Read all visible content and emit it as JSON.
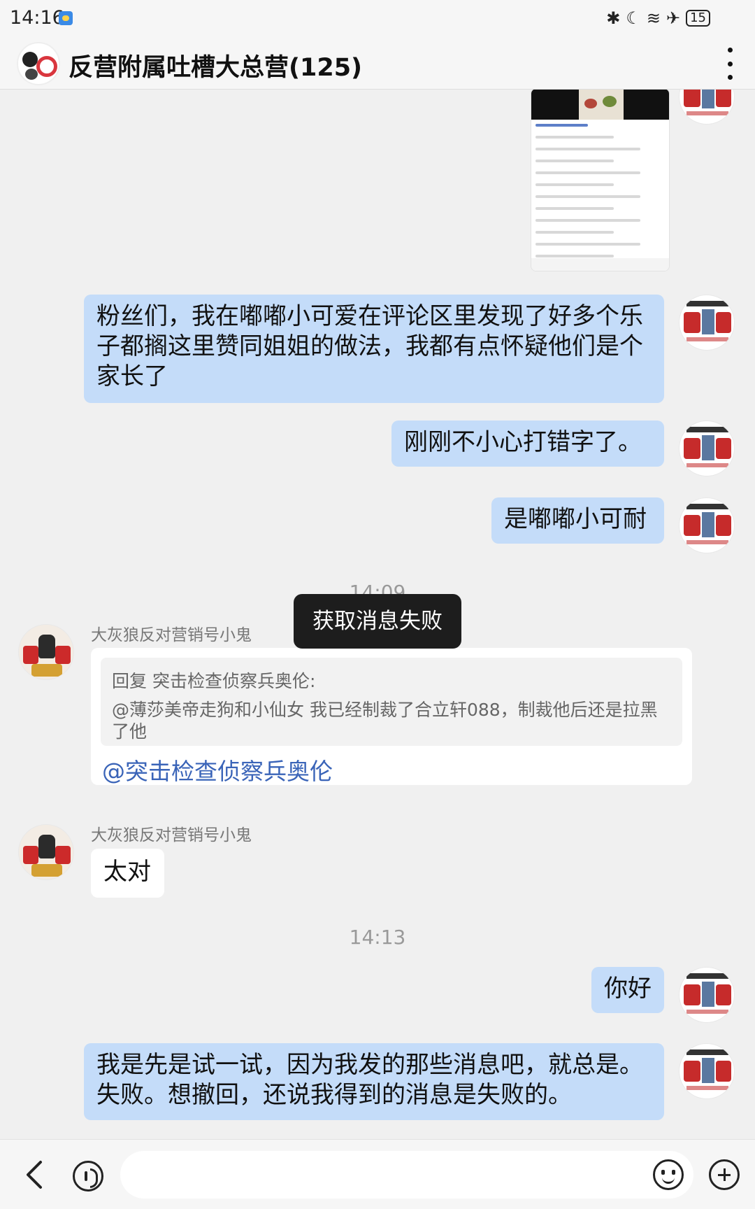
{
  "status_bar": {
    "time": "14:16",
    "battery": "15",
    "icons": [
      "weather-icon",
      "bluetooth-icon",
      "moon-icon",
      "wifi-icon",
      "airplane-icon",
      "battery-icon"
    ]
  },
  "header": {
    "title": "反营附属吐槽大总营(125)"
  },
  "messages": {
    "m1": "粉丝们，我在嘟嘟小可爱在评论区里发现了好多个乐子都搁这里赞同姐姐的做法，我都有点怀疑他们是个家长了",
    "m2": "刚刚不小心打错字了。",
    "m3": "是嘟嘟小可耐",
    "time1": "14:09",
    "sender1": "大灰狼反对营销号小鬼",
    "reply_head": "回复 突击检查侦察兵奥伦:",
    "reply_body": "@薄莎美帝走狗和小仙女 我已经制裁了合立轩088，制裁他后还是拉黑了他",
    "reply_mention": "@突击检查侦察兵奥伦",
    "sender2": "大灰狼反对营销号小鬼",
    "m4": "太对",
    "time2": "14:13",
    "m5": "你好",
    "m6": "我是先是试一试，因为我发的那些消息吧，就总是。失败。想撤回，还说我得到的消息是失败的。"
  },
  "toast": "获取消息失败",
  "input": {
    "value": "",
    "placeholder": ""
  },
  "colors": {
    "self_bubble": "#c4dcf9",
    "other_bubble": "#ffffff",
    "background": "#f0f0f0",
    "mention": "#3a64b8",
    "toast_bg": "#1d1d1d"
  }
}
